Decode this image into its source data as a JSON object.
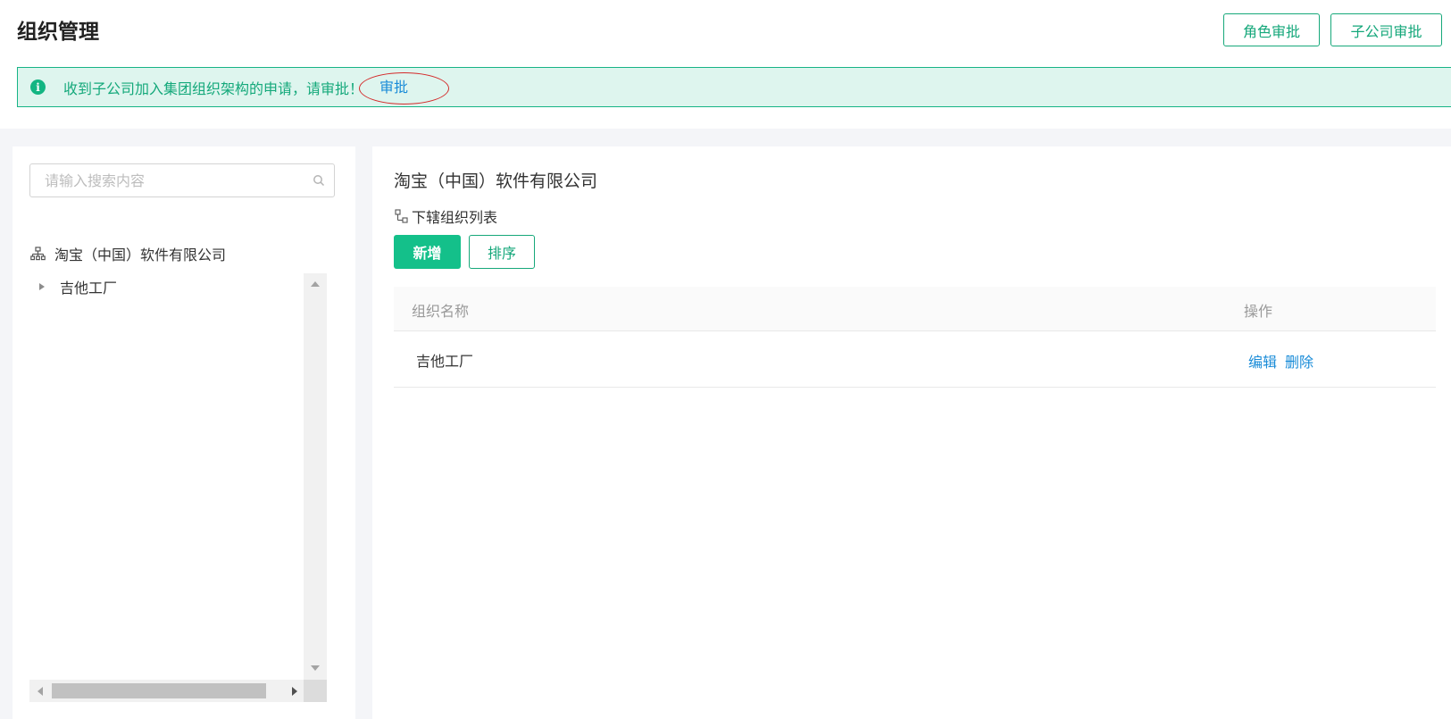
{
  "header": {
    "title": "组织管理",
    "role_approval": "角色审批",
    "subsidiary_approval": "子公司审批"
  },
  "alert": {
    "icon": "info-icon",
    "icon_glyph": "i",
    "message": "收到子公司加入集团组织架构的申请，请审批！",
    "link": "审批"
  },
  "sidebar": {
    "search_placeholder": "请输入搜索内容",
    "root": "淘宝（中国）软件有限公司",
    "children": [
      {
        "label": "吉他工厂"
      }
    ]
  },
  "main": {
    "title": "淘宝（中国）软件有限公司",
    "section": "下辖组织列表",
    "add": "新增",
    "sort": "排序",
    "columns": [
      "组织名称",
      "操作"
    ],
    "rows": [
      {
        "name": "吉他工厂",
        "edit": "编辑",
        "delete": "删除"
      }
    ]
  },
  "colors": {
    "primary": "#14c08a",
    "link": "#1a8cd8",
    "alert_bg": "#def5ee"
  }
}
